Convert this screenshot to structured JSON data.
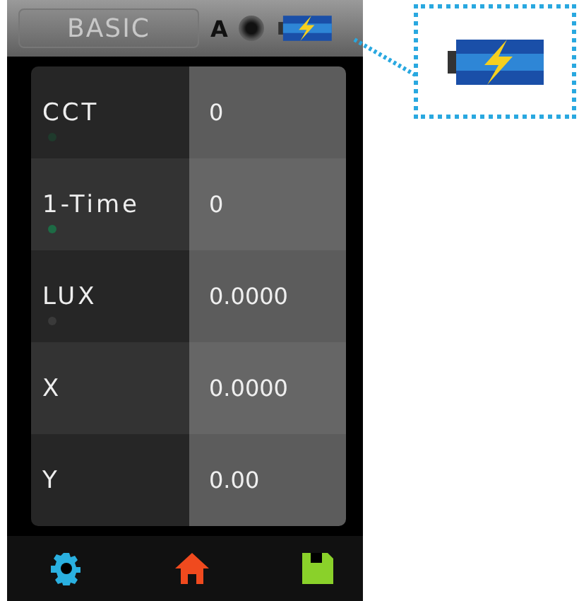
{
  "header": {
    "tab": "BASIC",
    "mode": "A"
  },
  "rows": [
    {
      "label": "CCT",
      "value": "0",
      "color": "#1f3a2c"
    },
    {
      "label": "1-Time",
      "value": "0",
      "color": "#1d6b45"
    },
    {
      "label": "LUX",
      "value": "0.0000",
      "color": "#3a3a3a"
    },
    {
      "label": "X",
      "value": "0.0000"
    },
    {
      "label": "Y",
      "value": "0.00"
    }
  ],
  "toolbar": [
    {
      "kind": "settings"
    },
    {
      "kind": "home"
    },
    {
      "kind": "save"
    }
  ],
  "callout": {
    "kind": "battery"
  }
}
